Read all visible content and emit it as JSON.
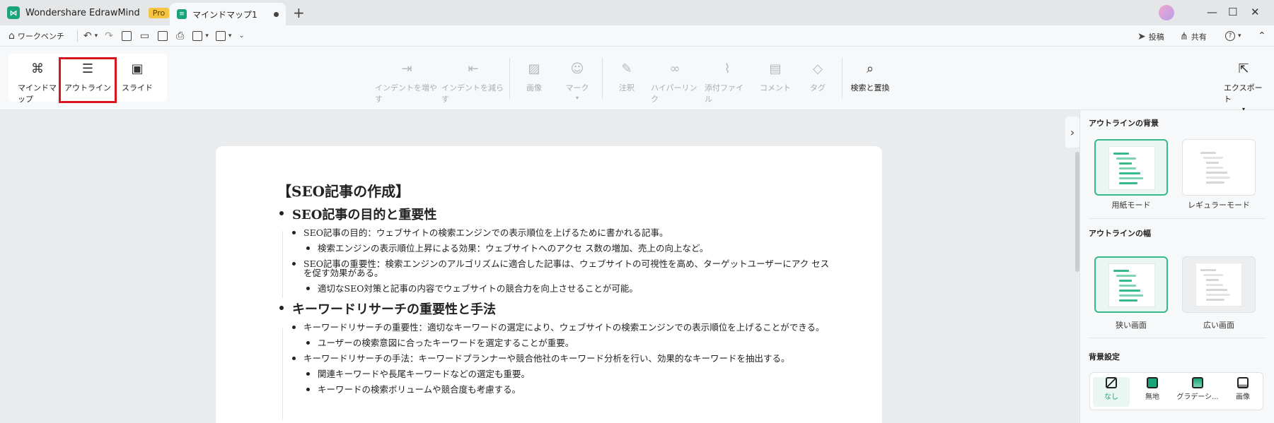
{
  "app": {
    "name": "Wondershare EdrawMind",
    "badge": "Pro",
    "logo_glyph": "⋈",
    "tab_title": "マインドマップ1",
    "new_tab": "+",
    "minimize": "—",
    "maximize": "☐",
    "close": "✕"
  },
  "quickbar": {
    "workbench": "ワークベンチ",
    "post": "投稿",
    "share": "共有",
    "help": "?"
  },
  "ribbon": {
    "views": [
      {
        "label": "マインドマップ",
        "icon": "mindmap-icon"
      },
      {
        "label": "アウトライン",
        "icon": "outline-icon"
      },
      {
        "label": "スライド",
        "icon": "slide-icon"
      }
    ],
    "indent": "インデントを増やす",
    "outdent": "インデントを減らす",
    "image": "画像",
    "mark": "マーク",
    "note": "注釈",
    "hyperlink": "ハイパーリンク",
    "attachment": "添付ファイル",
    "comment": "コメント",
    "tag": "タグ",
    "find_replace": "検索と置換",
    "export": "エクスポート"
  },
  "document": {
    "title": "【SEO記事の作成】",
    "sections": [
      {
        "heading": "SEO記事の目的と重要性",
        "items": [
          {
            "text": "SEO記事の目的：ウェブサイトの検索エンジンでの表示順位を上げるために書かれる記事。"
          },
          {
            "text": "検索エンジンの表示順位上昇による効果：ウェブサイトへのアクセ ス数の増加、売上の向上など。"
          },
          {
            "text": "SEO記事の重要性：検索エンジンのアルゴリズムに適合した記事は、ウェブサイトの可視性を高め、ターゲットユーザーにアク セスを促す効果がある。"
          },
          {
            "text": "適切なSEO対策と記事の内容でウェブサイトの競合力を向上させることが可能。"
          }
        ]
      },
      {
        "heading": "キーワードリサーチの重要性と手法",
        "items": [
          {
            "text": "キーワードリサーチの重要性：適切なキーワードの選定により、ウェブサイトの検索エンジンでの表示順位を上げることができる。"
          },
          {
            "text": "ユーザーの検索意図に合ったキーワードを選定することが重要。"
          },
          {
            "text": "キーワードリサーチの手法：キーワードプランナーや競合他社のキーワード分析を行い、効果的なキーワードを抽出する。"
          },
          {
            "text": "関連キーワードや長尾キーワードなどの選定も重要。"
          },
          {
            "text": "キーワードの検索ボリュームや競合度も考慮する。"
          }
        ]
      }
    ]
  },
  "panel": {
    "background_title": "アウトラインの背景",
    "paper_mode": "用紙モード",
    "regular_mode": "レギュラーモード",
    "width_title": "アウトラインの幅",
    "narrow": "狭い画面",
    "wide": "広い画面",
    "bg_settings_title": "背景設定",
    "bg_options": [
      "なし",
      "無地",
      "グラデーシ...",
      "画像"
    ]
  },
  "colors": {
    "accent": "#19a47a",
    "highlight_box": "#d8141e"
  }
}
